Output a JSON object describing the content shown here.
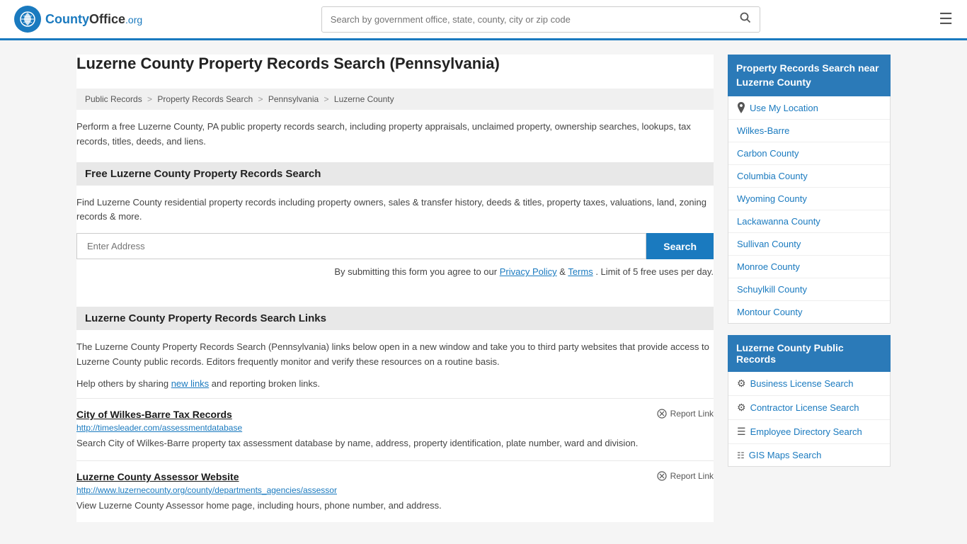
{
  "header": {
    "logo_text": "CountyOffice",
    "logo_org": ".org",
    "search_placeholder": "Search by government office, state, county, city or zip code"
  },
  "page": {
    "title": "Luzerne County Property Records Search (Pennsylvania)",
    "description": "Perform a free Luzerne County, PA public property records search, including property appraisals, unclaimed property, ownership searches, lookups, tax records, titles, deeds, and liens."
  },
  "breadcrumb": {
    "items": [
      {
        "label": "Public Records",
        "href": "#"
      },
      {
        "label": "Property Records Search",
        "href": "#"
      },
      {
        "label": "Pennsylvania",
        "href": "#"
      },
      {
        "label": "Luzerne County",
        "href": "#"
      }
    ]
  },
  "free_search": {
    "heading": "Free Luzerne County Property Records Search",
    "description": "Find Luzerne County residential property records including property owners, sales & transfer history, deeds & titles, property taxes, valuations, land, zoning records & more.",
    "input_placeholder": "Enter Address",
    "search_button": "Search",
    "form_note": "By submitting this form you agree to our",
    "privacy_policy": "Privacy Policy",
    "terms": "Terms",
    "limit_note": ". Limit of 5 free uses per day."
  },
  "links_section": {
    "heading": "Luzerne County Property Records Search Links",
    "description": "The Luzerne County Property Records Search (Pennsylvania) links below open in a new window and take you to third party websites that provide access to Luzerne County public records. Editors frequently monitor and verify these resources on a routine basis.",
    "share_note": "Help others by sharing",
    "new_links": "new links",
    "reporting": "and reporting broken links.",
    "links": [
      {
        "title": "City of Wilkes-Barre Tax Records",
        "url": "http://timesleader.com/assessmentdatabase",
        "description": "Search City of Wilkes-Barre property tax assessment database by name, address, property identification, plate number, ward and division.",
        "report_label": "Report Link"
      },
      {
        "title": "Luzerne County Assessor Website",
        "url": "http://www.luzernecounty.org/county/departments_agencies/assessor",
        "description": "View Luzerne County Assessor home page, including hours, phone number, and address.",
        "report_label": "Report Link"
      }
    ]
  },
  "sidebar": {
    "nearby_title": "Property Records Search near Luzerne County",
    "use_location": "Use My Location",
    "nearby_items": [
      {
        "label": "Wilkes-Barre"
      },
      {
        "label": "Carbon County"
      },
      {
        "label": "Columbia County"
      },
      {
        "label": "Wyoming County"
      },
      {
        "label": "Lackawanna County"
      },
      {
        "label": "Sullivan County"
      },
      {
        "label": "Monroe County"
      },
      {
        "label": "Schuylkill County"
      },
      {
        "label": "Montour County"
      }
    ],
    "public_records_title": "Luzerne County Public Records",
    "public_records_items": [
      {
        "label": "Business License Search",
        "icon": "gear"
      },
      {
        "label": "Contractor License Search",
        "icon": "gear"
      },
      {
        "label": "Employee Directory Search",
        "icon": "list"
      },
      {
        "label": "GIS Maps Search",
        "icon": "map"
      }
    ]
  }
}
